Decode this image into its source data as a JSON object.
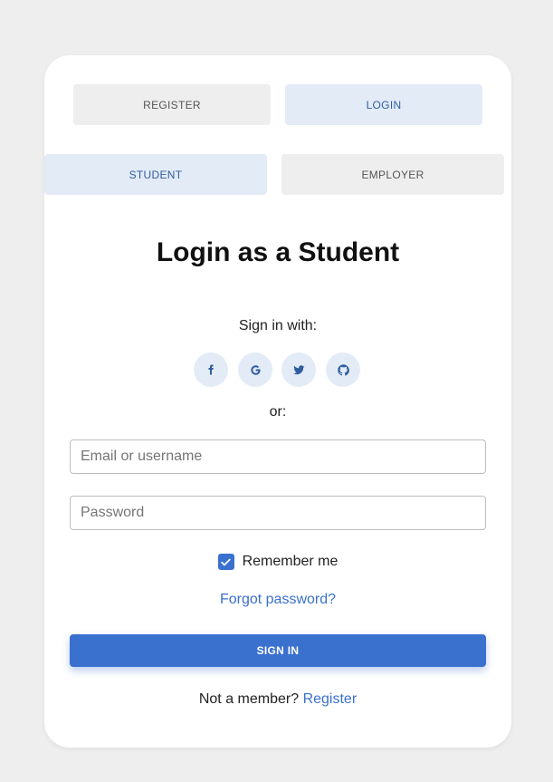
{
  "top_tabs": {
    "register": "REGISTER",
    "login": "LOGIN",
    "active": "login"
  },
  "role_tabs": {
    "student": "STUDENT",
    "employer": "EMPLOYER",
    "active": "student"
  },
  "title": "Login as a Student",
  "social": {
    "label": "Sign in with:",
    "icons": [
      "facebook-icon",
      "google-icon",
      "twitter-icon",
      "github-icon"
    ]
  },
  "or_label": "or:",
  "form": {
    "email_placeholder": "Email or username",
    "email_value": "",
    "password_placeholder": "Password",
    "password_value": "",
    "remember_label": "Remember me",
    "remember_checked": true,
    "forgot_label": "Forgot password?",
    "submit_label": "SIGN IN"
  },
  "footer": {
    "text": "Not a member?",
    "link": "Register"
  },
  "colors": {
    "accent": "#3a70ce",
    "tab_active_bg": "#e3ebf7",
    "tab_inactive_bg": "#eeeeee",
    "page_bg": "#eeeeee"
  }
}
